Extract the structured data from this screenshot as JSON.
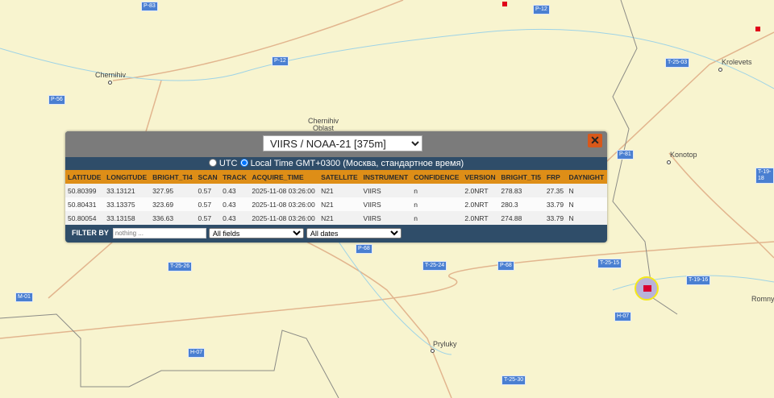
{
  "map": {
    "cities": [
      {
        "name": "Chernihiv"
      },
      {
        "name": "Chernihiv Oblast"
      },
      {
        "name": "Krolevets"
      },
      {
        "name": "Konotop"
      },
      {
        "name": "Pryluky"
      },
      {
        "name": "Romny"
      }
    ],
    "roads": [
      "P-83",
      "P-12",
      "P-12",
      "P-56",
      "T-25-03",
      "P-81",
      "T-19-18",
      "T-25-26",
      "P-68",
      "T-25-24",
      "P-68",
      "T-25-15",
      "T-19-16",
      "M-01",
      "H-07",
      "H-07",
      "T-25-30"
    ],
    "fire_color": "#e0001a"
  },
  "popup": {
    "satellite_select": "VIIRS / NOAA-21 [375m]",
    "close_label": "✕",
    "tz_utc": "UTC",
    "tz_local": "Local Time GMT+0300 (Москва, стандартное время)",
    "tz_selected": "local",
    "columns": [
      "LATITUDE",
      "LONGITUDE",
      "BRIGHT_TI4",
      "SCAN",
      "TRACK",
      "ACQUIRE_TIME",
      "SATELLITE",
      "INSTRUMENT",
      "CONFIDENCE",
      "VERSION",
      "BRIGHT_TI5",
      "FRP",
      "DAYNIGHT"
    ],
    "rows": [
      [
        "50.80399",
        "33.13121",
        "327.95",
        "0.57",
        "0.43",
        "2025-11-08 03:26:00",
        "N21",
        "VIIRS",
        "n",
        "2.0NRT",
        "278.83",
        "27.35",
        "N"
      ],
      [
        "50.80431",
        "33.13375",
        "323.69",
        "0.57",
        "0.43",
        "2025-11-08 03:26:00",
        "N21",
        "VIIRS",
        "n",
        "2.0NRT",
        "280.3",
        "33.79",
        "N"
      ],
      [
        "50.80054",
        "33.13158",
        "336.63",
        "0.57",
        "0.43",
        "2025-11-08 03:26:00",
        "N21",
        "VIIRS",
        "n",
        "2.0NRT",
        "274.88",
        "33.79",
        "N"
      ]
    ],
    "filter_label": "FILTER BY",
    "filter_placeholder": "nothing ...",
    "fields_select": "All fields",
    "dates_select": "All dates"
  }
}
